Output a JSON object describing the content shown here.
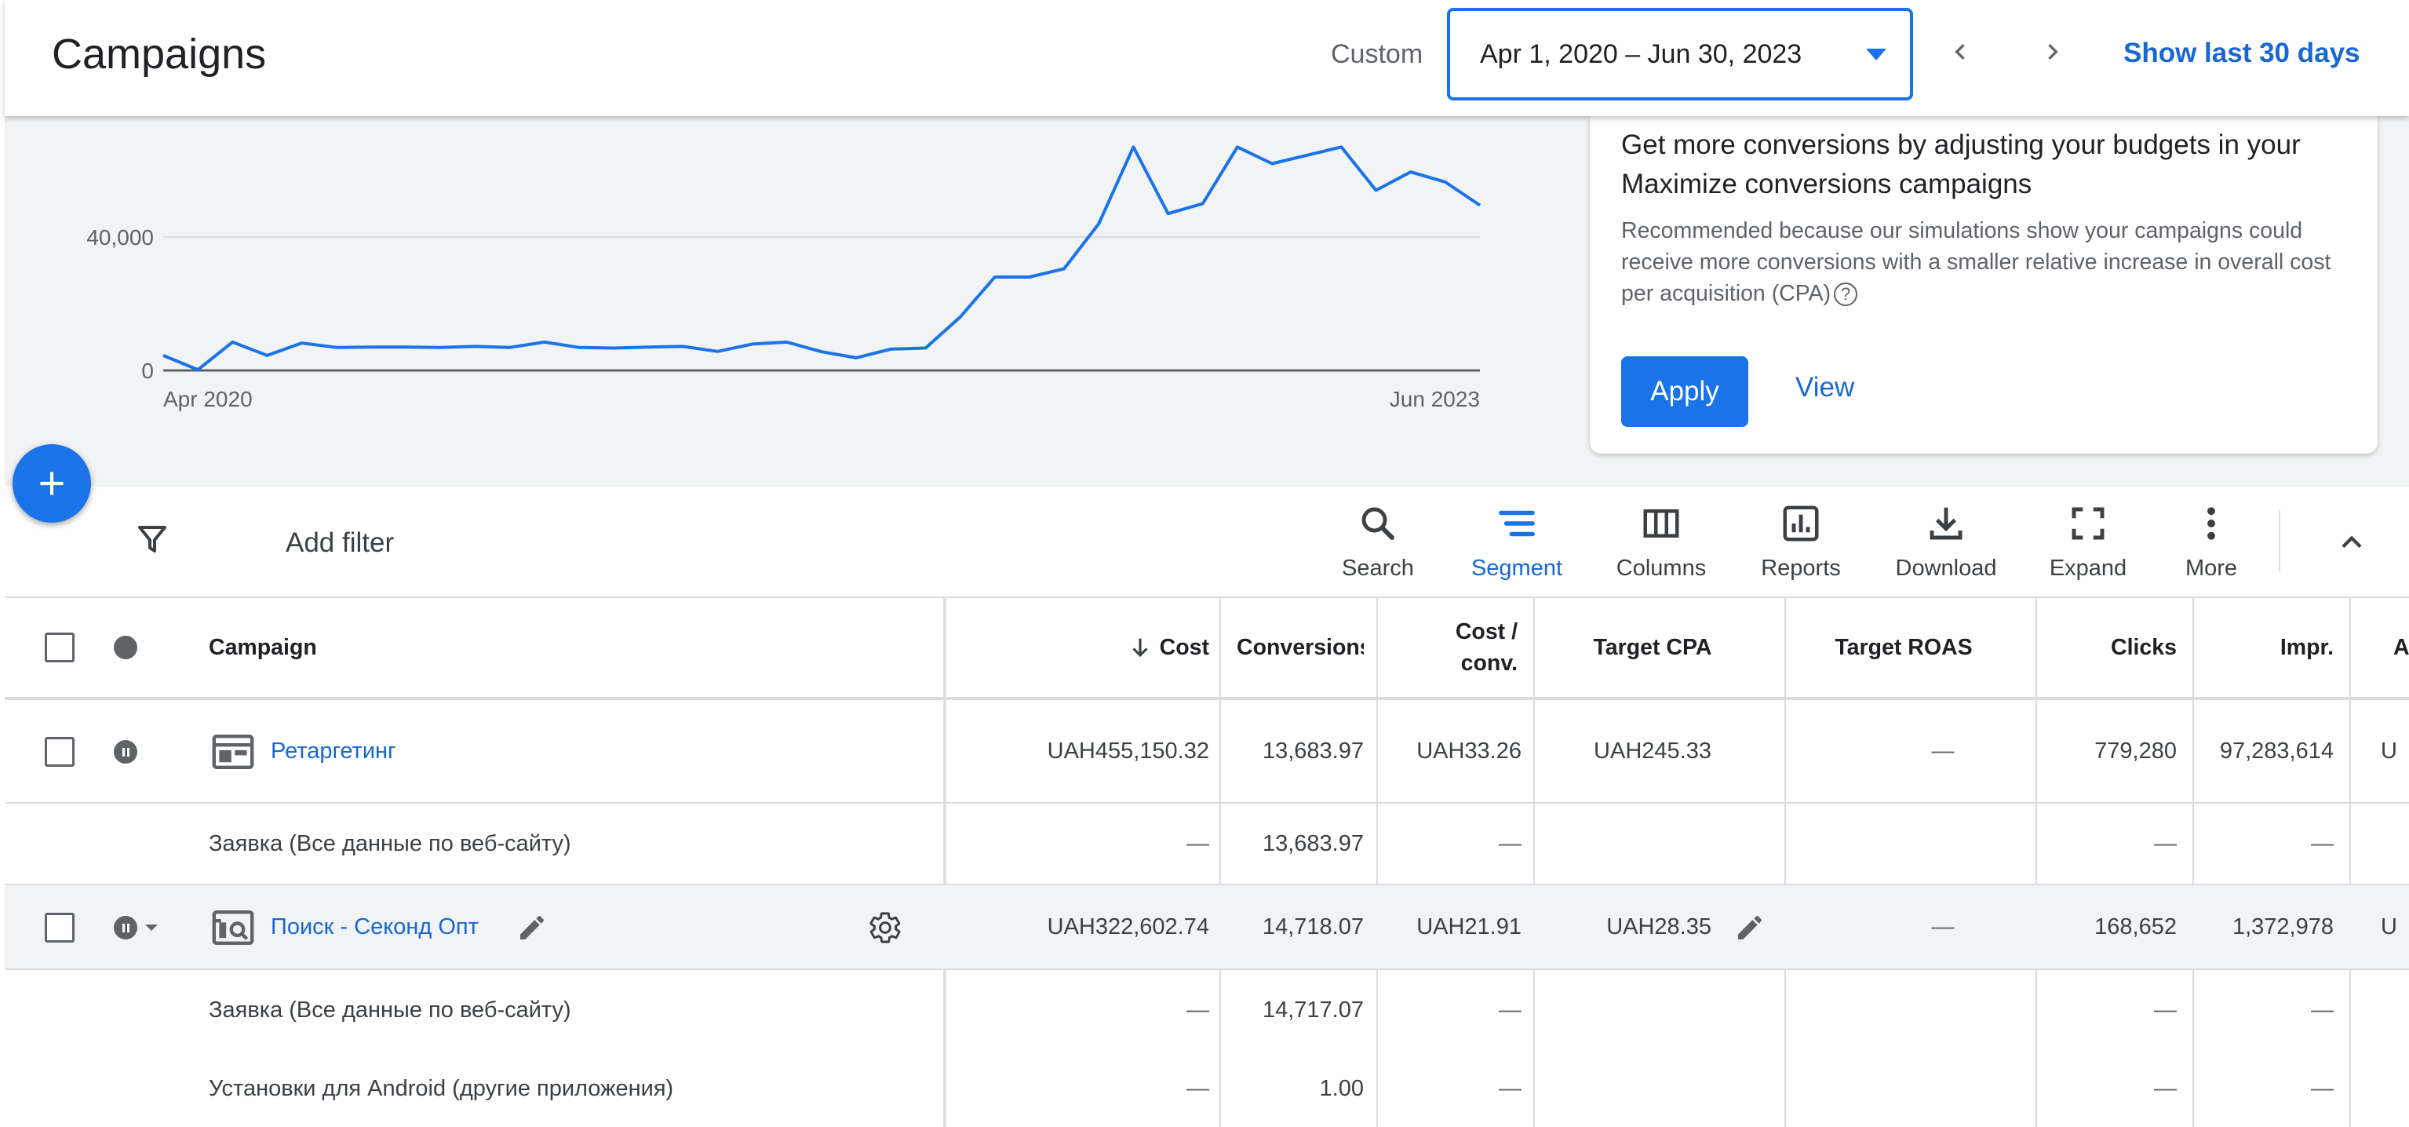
{
  "header": {
    "title": "Campaigns",
    "range_label": "Custom",
    "date_range": "Apr 1, 2020 – Jun 30, 2023",
    "show_last": "Show last 30 days"
  },
  "chart_data": {
    "type": "line",
    "x_start": "Apr 2020",
    "x_end": "Jun 2023",
    "x_tick_labels": [
      "Apr 2020",
      "Jun 2023"
    ],
    "y_tick_labels": [
      "0",
      "40,000"
    ],
    "y_ticks": [
      0,
      40000
    ],
    "ylim": [
      0,
      70000
    ],
    "series": [
      {
        "values": [
          4500,
          200,
          8500,
          4500,
          8200,
          6900,
          7000,
          7000,
          6900,
          7200,
          6900,
          8500,
          6900,
          6700,
          7000,
          7200,
          5700,
          7900,
          8500,
          5600,
          3800,
          6400,
          6700,
          16000,
          28000,
          28000,
          30500,
          44000,
          67000,
          47000,
          50000,
          67000,
          62000,
          64500,
          67000,
          54000,
          59500,
          56500,
          49500
        ],
        "color": "#1a73e8"
      }
    ],
    "grid": true
  },
  "recommendation": {
    "title": "Get more conversions by adjusting your budgets in your Maximize conversions campaigns",
    "body": "Recommended because our simulations show your campaigns could receive more conversions with a smaller relative increase in overall cost per acquisition (CPA)",
    "help_glyph": "?",
    "apply": "Apply",
    "view": "View"
  },
  "toolbar": {
    "add_filter": "Add filter",
    "tools": [
      {
        "label": "Search",
        "icon": "search-icon"
      },
      {
        "label": "Segment",
        "icon": "segment-icon",
        "active": true
      },
      {
        "label": "Columns",
        "icon": "columns-icon"
      },
      {
        "label": "Reports",
        "icon": "reports-icon"
      },
      {
        "label": "Download",
        "icon": "download-icon"
      },
      {
        "label": "Expand",
        "icon": "expand-icon"
      },
      {
        "label": "More",
        "icon": "more-vert-icon"
      }
    ]
  },
  "table": {
    "headers": {
      "campaign": "Campaign",
      "cost": "Cost",
      "conversions": "Conversions",
      "cost_conv_1": "Cost /",
      "cost_conv_2": "conv.",
      "target_cpa": "Target CPA",
      "target_roas": "Target ROAS",
      "clicks": "Clicks",
      "impr": "Impr.",
      "next": "A"
    },
    "rows": [
      {
        "campaign": "Ретаргетинг",
        "cost": "UAH455,150.32",
        "conversions": "13,683.97",
        "cost_conv": "UAH33.26",
        "target_cpa": "UAH245.33",
        "target_roas": "—",
        "clicks": "779,280",
        "impr": "97,283,614",
        "next": "U"
      },
      {
        "campaign": "Заявка (Все данные по веб-сайту)",
        "cost": "—",
        "conversions": "13,683.97",
        "cost_conv": "—",
        "clicks": "—",
        "impr": "—"
      },
      {
        "campaign": "Поиск - Секонд Опт",
        "cost": "UAH322,602.74",
        "conversions": "14,718.07",
        "cost_conv": "UAH21.91",
        "target_cpa": "UAH28.35",
        "target_roas": "—",
        "clicks": "168,652",
        "impr": "1,372,978",
        "next": "U"
      },
      {
        "campaign": "Заявка (Все данные по веб-сайту)",
        "cost": "—",
        "conversions": "14,717.07",
        "cost_conv": "—",
        "clicks": "—",
        "impr": "—"
      },
      {
        "campaign": "Установки для Android (другие приложения)",
        "cost": "—",
        "conversions": "1.00",
        "cost_conv": "—",
        "clicks": "—",
        "impr": "—"
      }
    ]
  }
}
